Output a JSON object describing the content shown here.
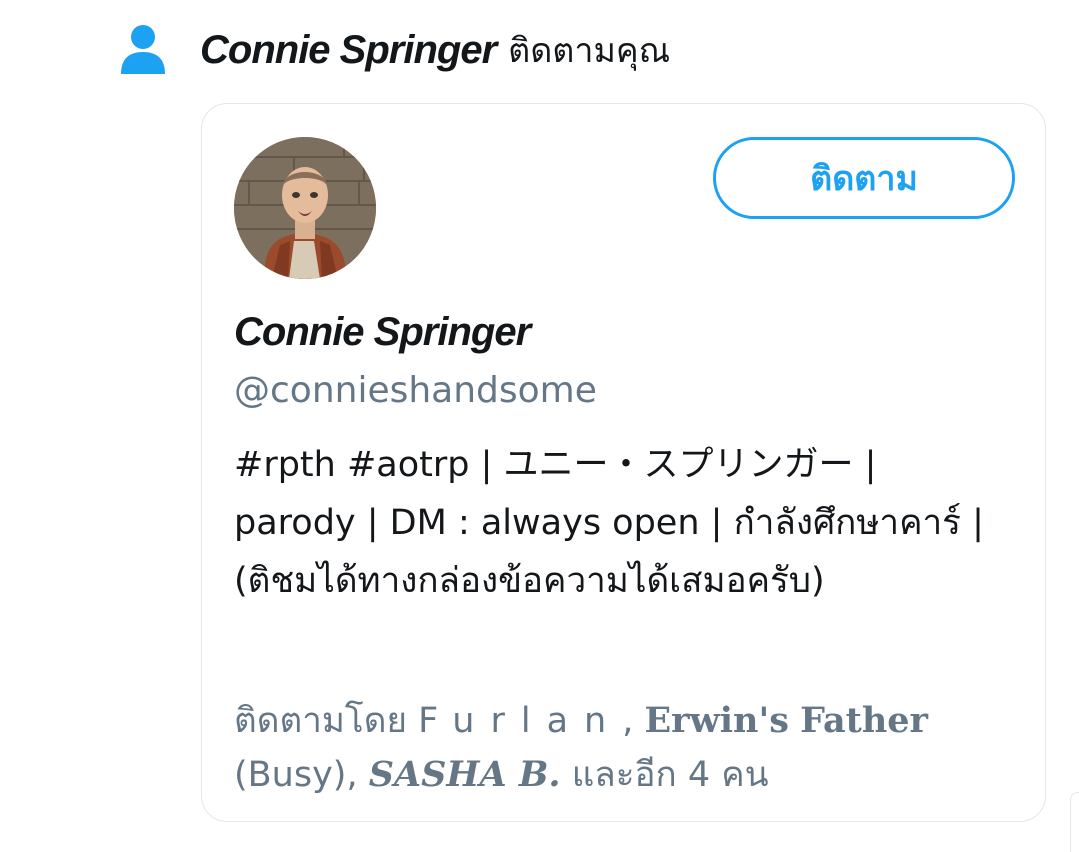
{
  "notification": {
    "icon": "person-icon",
    "actor_name": "Connie Springer",
    "action_text": "ติดตามคุณ"
  },
  "profile_card": {
    "avatar": "profile-avatar",
    "follow_button_label": "ติดตาม",
    "display_name": "Connie Springer",
    "handle": "@connieshandsome",
    "bio": "#rpth #aotrp | ユニー・スプリンガー | parody | DM : always open | กำลังศึกษาคาร์ | (ติชมได้ทางกล่องข้อความได้เสมอครับ)",
    "followed_by": {
      "prefix": "ติดตามโดย ",
      "follower_1": "Furlan",
      "sep_1": ", ",
      "follower_2_a": "Erwin's",
      "follower_2_b": "Father",
      "follower_2_c": " (Busy)",
      "sep_2": ", ",
      "follower_3": "SASHA B.",
      "suffix": " และอีก 4 คน"
    }
  },
  "colors": {
    "accent": "#1da1f2",
    "text_primary": "#14171a",
    "text_secondary": "#657786",
    "border": "#e1e8ed"
  }
}
